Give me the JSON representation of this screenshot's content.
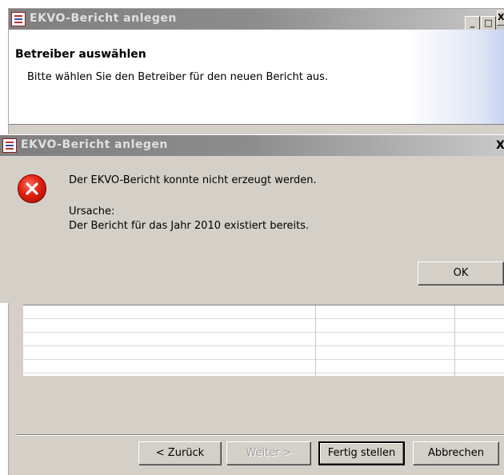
{
  "wizard": {
    "title": "EKVO-Bericht anlegen",
    "header_title": "Betreiber auswählen",
    "header_description": "Bitte wählen Sie den Betreiber für den neuen Bericht aus.",
    "window_buttons": {
      "minimize": "_",
      "maximize": "□",
      "close": "X"
    },
    "buttons": {
      "back": "< Zurück",
      "next": "Weiter >",
      "finish": "Fertig stellen",
      "cancel": "Abbrechen"
    }
  },
  "error_dialog": {
    "title": "EKVO-Bericht anlegen",
    "close": "X",
    "message": "Der EKVO-Bericht konnte nicht erzeugt werden.",
    "cause_label": "Ursache:",
    "cause_text": "Der Bericht für das Jahr 2010 existiert bereits.",
    "ok_label": "OK",
    "icon": "error-icon"
  }
}
